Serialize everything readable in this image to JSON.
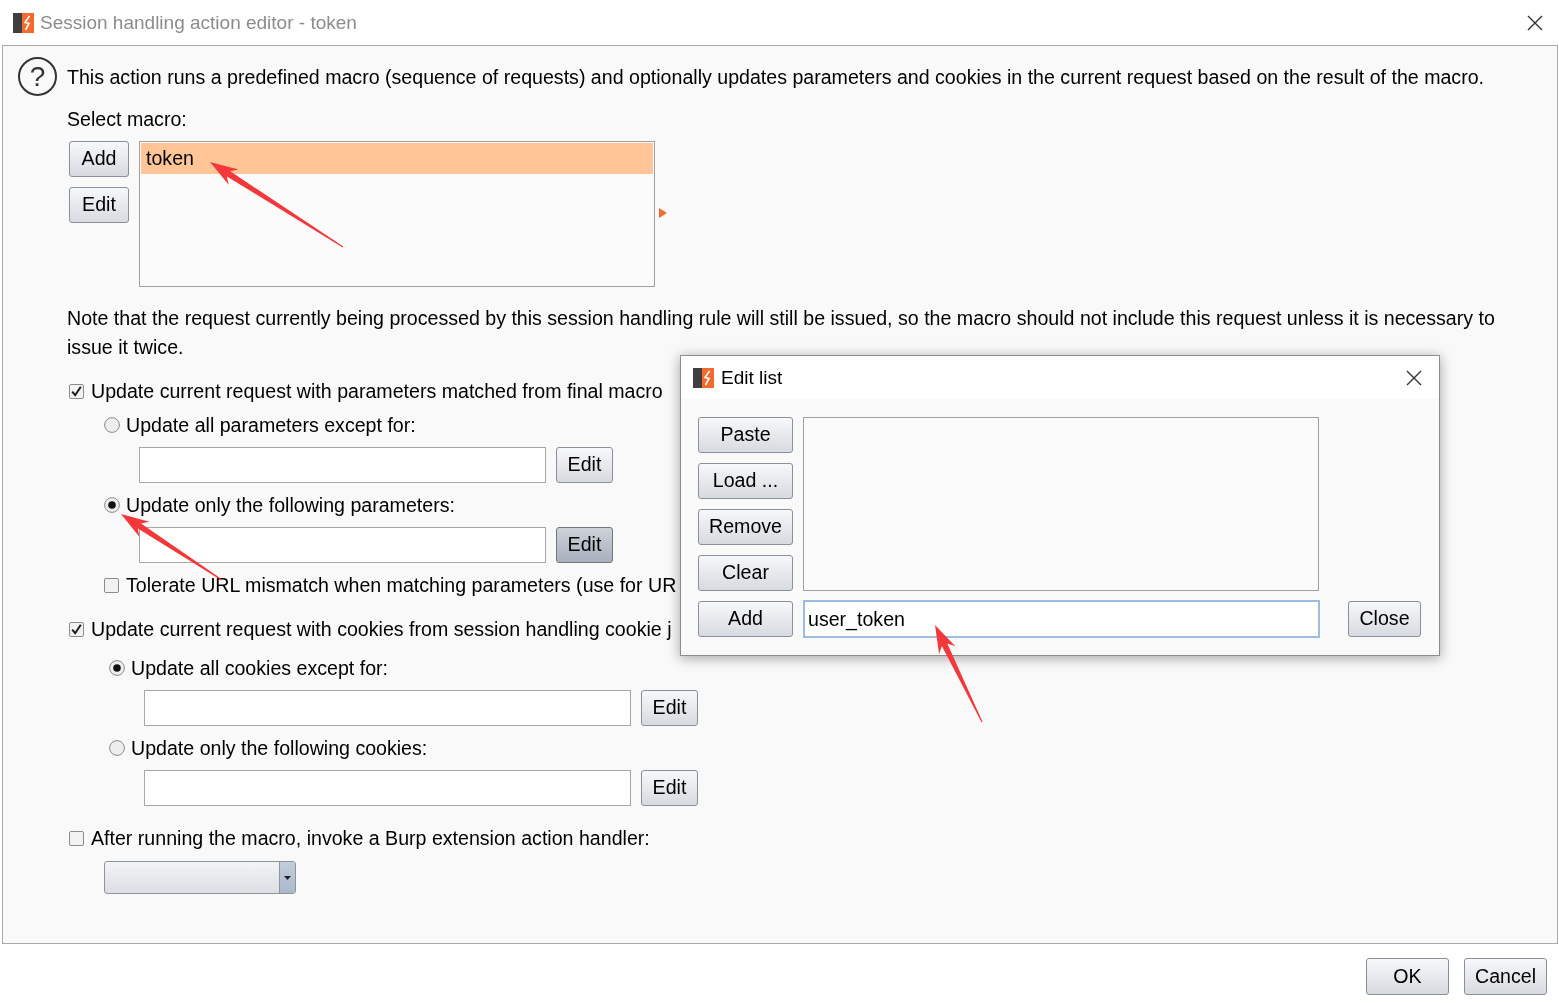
{
  "window": {
    "title": "Session handling action editor - token"
  },
  "intro": {
    "icon": "?",
    "text": "This action runs a predefined macro (sequence of requests) and optionally updates parameters and cookies in the current request based on the result of the macro."
  },
  "macro": {
    "label": "Select macro:",
    "buttons": [
      "Add",
      "Edit"
    ],
    "items": [
      {
        "label": "token",
        "selected": true
      }
    ]
  },
  "note": "Note that the request currently being processed by this session handling rule will still be issued, so the macro should not include this request unless it is necessary to issue it twice.",
  "parameters": {
    "label": "Update current request with parameters matched from final macro",
    "checked": true,
    "options": [
      {
        "label": "Update all parameters except for:",
        "selected": false,
        "edit": {
          "label": "Edit",
          "pressed": false
        }
      },
      {
        "label": "Update only the following parameters:",
        "selected": true,
        "edit": {
          "label": "Edit",
          "pressed": true
        }
      }
    ],
    "tolerate": {
      "label": "Tolerate URL mismatch when matching parameters (use for UR",
      "checked": false
    }
  },
  "cookies": {
    "label": "Update current request with cookies from session handling cookie j",
    "checked": true,
    "options": [
      {
        "label": "Update all cookies except for:",
        "selected": true,
        "edit": {
          "label": "Edit",
          "pressed": false
        }
      },
      {
        "label": "Update only the following cookies:",
        "selected": false,
        "edit": {
          "label": "Edit",
          "pressed": false
        }
      }
    ]
  },
  "extension": {
    "label": "After running the macro, invoke a Burp extension action handler:",
    "checked": false
  },
  "buttons": [
    "OK",
    "Cancel"
  ],
  "edit_list": {
    "title": "Edit list",
    "buttons": [
      "Paste",
      "Load ...",
      "Remove",
      "Clear"
    ],
    "add_button": "Add",
    "input": {
      "value": "user_token",
      "focused": true
    },
    "close_button": "Close"
  }
}
